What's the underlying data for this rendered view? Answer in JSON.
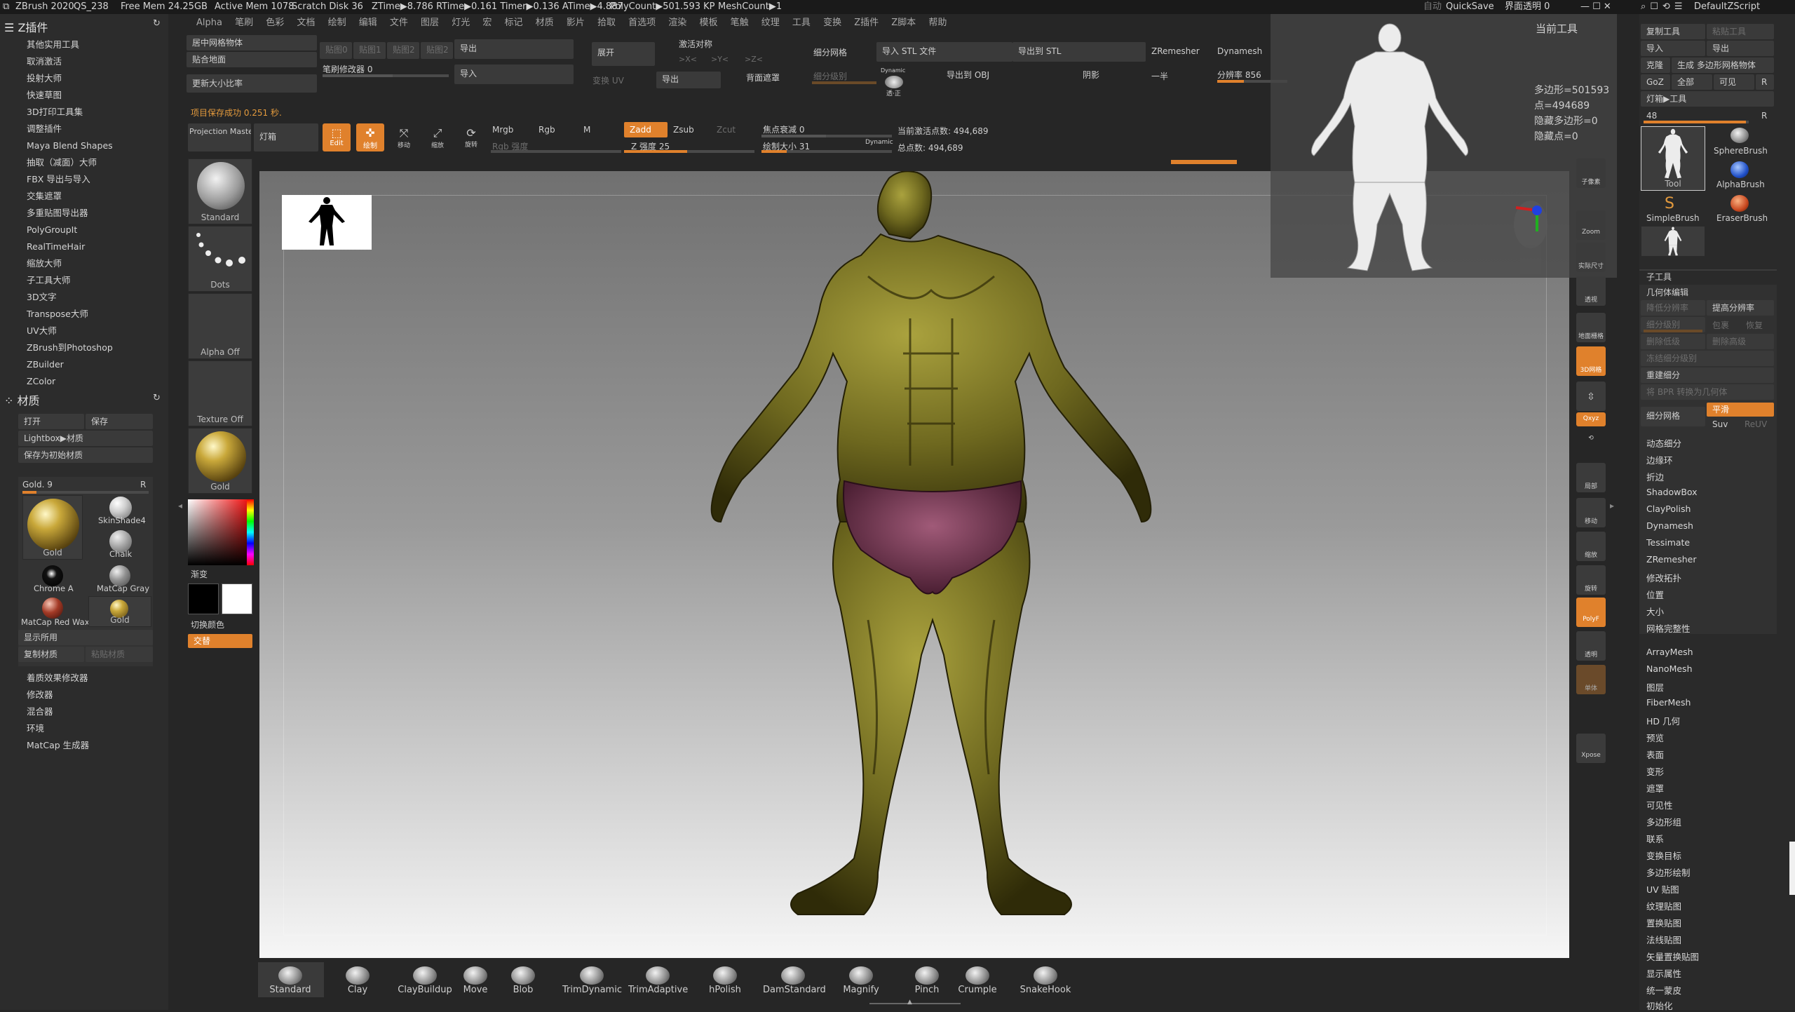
{
  "titlebar": {
    "app": "ZBrush 2020",
    "file": "QS_238",
    "stats": [
      "Free Mem 24.25GB",
      "Active Mem 1078",
      "Scratch Disk 36",
      "ZTime▶8.786 RTime▶0.161 Timer▶0.136 ATime▶4.887",
      "PolyCount▶501.593 KP",
      "MeshCount▶1"
    ],
    "auto": "自动",
    "quicksave": "QuickSave",
    "transparency": "界面透明 0",
    "script": "DefaultZScript"
  },
  "menu": [
    "Alpha",
    "笔刷",
    "色彩",
    "文档",
    "绘制",
    "编辑",
    "文件",
    "图层",
    "灯光",
    "宏",
    "标记",
    "材质",
    "影片",
    "拾取",
    "首选项",
    "渲染",
    "模板",
    "笔触",
    "纹理",
    "工具",
    "变换",
    "Z插件",
    "Z脚本",
    "帮助"
  ],
  "left_panel": {
    "zplugin_title": "Z插件",
    "zplugin_items": [
      "其他实用工具",
      "取消激活",
      "投射大师",
      "快速草图",
      "3D打印工具集",
      "调整插件",
      "Maya Blend Shapes",
      "抽取（减面）大师",
      "FBX 导出与导入",
      "交集遮罩",
      "多重贴图导出器",
      "PolyGroupIt",
      "RealTimeHair",
      "缩放大师",
      "子工具大师",
      "3D文字",
      "Transpose大师",
      "UV大师",
      "ZBrush到Photoshop",
      "ZBuilder",
      "ZColor"
    ],
    "material_title": "材质",
    "open": "打开",
    "save": "保存",
    "lightbox": "Lightbox▶材质",
    "save_initial": "保存为初始材质",
    "current_mat": "Gold. 9",
    "r": "R",
    "materials": [
      "Gold",
      "SkinShade4",
      "Chalk",
      "Chrome A",
      "MatCap Gray",
      "MatCap Red Wax",
      "Gold"
    ],
    "show_used": "显示所用",
    "copy_mat": "复制材质",
    "paste_mat": "粘贴材质",
    "submenu": [
      "着质效果修改器",
      "修改器",
      "混合器",
      "环境",
      "MatCap 生成器"
    ]
  },
  "top_shelf": {
    "center_mesh": "居中网格物体",
    "snap_ground": "贴合地面",
    "update_scale": "更新大小比率",
    "brush_modifier": "笔刷修改器 0",
    "tex_slots": [
      "贴图0",
      "贴图1",
      "贴图2",
      "贴图2"
    ],
    "export": "导出",
    "import": "导入",
    "expand": "展开",
    "activate_sym": "激活对称",
    "sym_x": ">X<",
    "sym_y": ">Y<",
    "sym_z": ">Z<",
    "flip_uv": "变换 UV",
    "export2": "导出",
    "back_mask": "背面遮罩",
    "subdiv_mesh": "细分网格",
    "subdiv_level": "细分级别",
    "import_stl": "导入 STL 文件",
    "export_stl": "导出到 STL",
    "export_obj": "导出到 OBJ",
    "shadow": "阴影",
    "zremesher": "ZRemesher",
    "half": "一半",
    "dynamesh": "Dynamesh",
    "resolution": "分辨率 856",
    "dynamic": "Dynamic",
    "dynamic_sub": "透·正",
    "save_notice": "项目保存成功 0.251 秒.",
    "projection_master": "Projection Master",
    "lightbox": "灯箱",
    "edit": "Edit",
    "draw": "绘制",
    "move": "移动",
    "scale": "缩放",
    "rotate": "旋转",
    "mrgb": "Mrgb",
    "rgb": "Rgb",
    "m": "M",
    "rgb_strength": "Rgb 强度",
    "zadd": "Zadd",
    "zsub": "Zsub",
    "zcut": "Zcut",
    "z_intensity": "Z 强度 25",
    "focal_shift": "焦点衰减 0",
    "draw_size": "绘制大小 31",
    "dynamic2": "Dynamic",
    "active_points": "当前激活点数: 494,689",
    "total_points": "总点数: 494,689"
  },
  "left_shelf": {
    "standard": "Standard",
    "dots": "Dots",
    "alpha_off": "Alpha Off",
    "texture_off": "Texture Off",
    "gold": "Gold",
    "gradient": "渐变",
    "switch_color": "切换颜色",
    "alternate": "交替"
  },
  "current_tool": {
    "title": "当前工具",
    "polys": "多边形=501593",
    "points": "点=494689",
    "hidden_polys": "隐藏多边形=0",
    "hidden_points": "隐藏点=0"
  },
  "right_icons": [
    "子像素",
    "Zoom",
    "实际尺寸",
    "透视",
    "地面栅格",
    "3D网格",
    "Qxyz",
    "局部",
    "移动",
    "缩放",
    "旋转",
    "PolyF",
    "透明",
    "单体",
    "Xpose"
  ],
  "right_panel": {
    "copy_tool": "复制工具",
    "paste_tool": "粘贴工具",
    "import": "导入",
    "export": "导出",
    "clone": "克隆",
    "gen_poly": "生成 多边形网格物体",
    "goz": "GoZ",
    "all": "全部",
    "visible": "可见",
    "r": "R",
    "lightbox_tool": "灯箱▶工具",
    "count": "48",
    "tools": [
      "Tool",
      "SphereBrush",
      "AlphaBrush",
      "SimpleBrush",
      "EraserBrush"
    ],
    "subtool": "子工具",
    "geometry": "几何体编辑",
    "lower_res": "降低分辨率",
    "higher_res": "提高分辨率",
    "sdiv": "细分级别",
    "cage": "包裹",
    "rstr": "恢复",
    "del_lower": "删除低级",
    "del_higher": "删除高级",
    "freeze_sub": "冻结细分级别",
    "reconstruct": "重建细分",
    "bpr_convert": "将 BPR 转换为几何体",
    "divide": "细分网格",
    "smooth": "平滑",
    "suv": "Suv",
    "reuv": "ReUV",
    "items": [
      "动态细分",
      "边缘环",
      "折边",
      "ShadowBox",
      "ClayPolish",
      "Dynamesh",
      "Tessimate",
      "ZRemesher",
      "修改拓扑",
      "位置",
      "大小",
      "网格完整性"
    ],
    "items2": [
      "ArrayMesh",
      "NanoMesh",
      "图层",
      "FiberMesh",
      "HD 几何",
      "预览",
      "表面",
      "变形",
      "遮罩",
      "可见性",
      "多边形组",
      "联系",
      "变换目标",
      "多边形绘制",
      "UV 贴图",
      "纹理贴图",
      "置换贴图",
      "法线贴图",
      "矢量置换贴图",
      "显示属性",
      "统一蒙皮",
      "初始化"
    ]
  },
  "brushes": [
    "Standard",
    "Clay",
    "ClayBuildup",
    "Move",
    "Blob",
    "TrimDynamic",
    "TrimAdaptive",
    "hPolish",
    "DamStandard",
    "Magnify",
    "Pinch",
    "Crumple",
    "SnakeHook"
  ]
}
